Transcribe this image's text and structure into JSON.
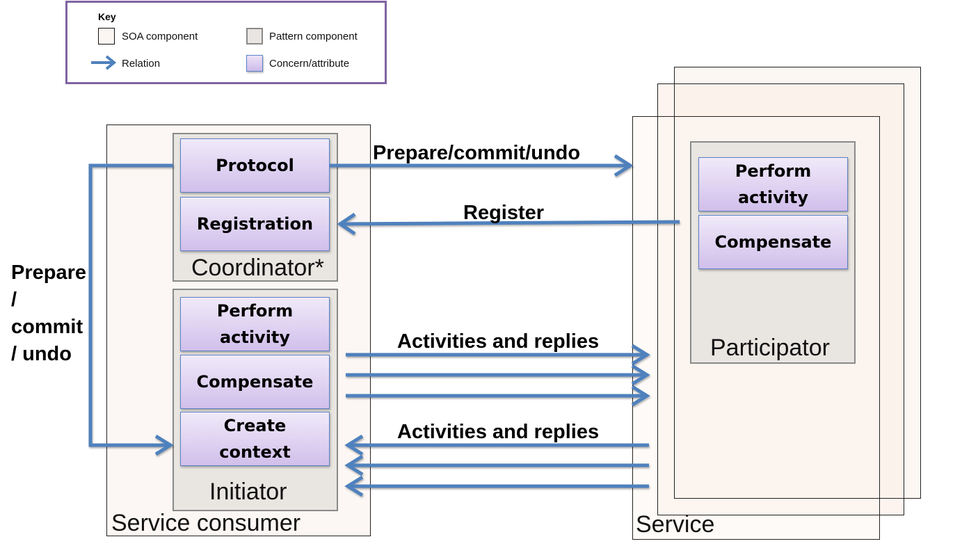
{
  "key": {
    "title": "Key",
    "items": [
      {
        "label": "SOA component",
        "icon": "soa-component-swatch"
      },
      {
        "label": "Pattern component",
        "icon": "pattern-component-swatch"
      },
      {
        "label": "Relation",
        "icon": "arrow-icon"
      },
      {
        "label": "Concern/attribute",
        "icon": "concern-swatch"
      }
    ]
  },
  "consumer": {
    "label": "Service consumer",
    "coordinator": {
      "label": "Coordinator*",
      "concerns": [
        "Protocol",
        "Registration"
      ]
    },
    "initiator": {
      "label": "Initiator",
      "concerns": [
        "Perform activity",
        "Compensate",
        "Create context"
      ]
    }
  },
  "service": {
    "label": "Service",
    "participator": {
      "label": "Participator",
      "concerns": [
        "Perform activity",
        "Compensate"
      ]
    }
  },
  "relations": {
    "prepare_commit_undo": "Prepare/commit/undo",
    "register": "Register",
    "activities_out": "Activities and replies",
    "activities_in": "Activities and replies",
    "loop_line1": "Prepare",
    "loop_line2": "/",
    "loop_line3": "commit",
    "loop_line4": "/ undo"
  },
  "colors": {
    "arrow": "#4f81bd",
    "key_border": "#8064a2",
    "concern_border": "#5a82c4",
    "pattern_fill": "#e9e5e1",
    "soa_fill": "#fcf6f2"
  }
}
